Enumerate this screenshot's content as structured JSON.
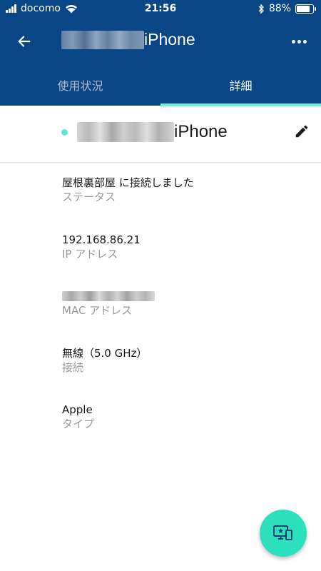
{
  "status_bar": {
    "carrier": "docomo",
    "time": "21:56",
    "battery_percent": "88%",
    "battery_level": 0.88
  },
  "app_bar": {
    "title_suffix": "iPhone",
    "back_icon": "arrow-left-icon",
    "more_icon": "more-horizontal-icon"
  },
  "tabs": [
    {
      "label": "使用状況",
      "active": false
    },
    {
      "label": "詳細",
      "active": true
    }
  ],
  "device": {
    "name_suffix": "iPhone",
    "status_color": "#5fe8cf",
    "edit_icon": "pencil-icon"
  },
  "details": [
    {
      "value": "屋根裏部屋 に接続しました",
      "label": "ステータス"
    },
    {
      "value": "192.168.86.21",
      "label": "IP アドレス"
    },
    {
      "value": "",
      "label": "MAC アドレス",
      "redacted": true
    },
    {
      "value": "無線（5.0 GHz）",
      "label": "接続"
    },
    {
      "value": "Apple",
      "label": "タイプ"
    }
  ],
  "fab": {
    "icon": "devices-star-icon"
  },
  "colors": {
    "primary": "#0a4585",
    "accent": "#6ff0d4",
    "fab": "#2de0bd"
  }
}
